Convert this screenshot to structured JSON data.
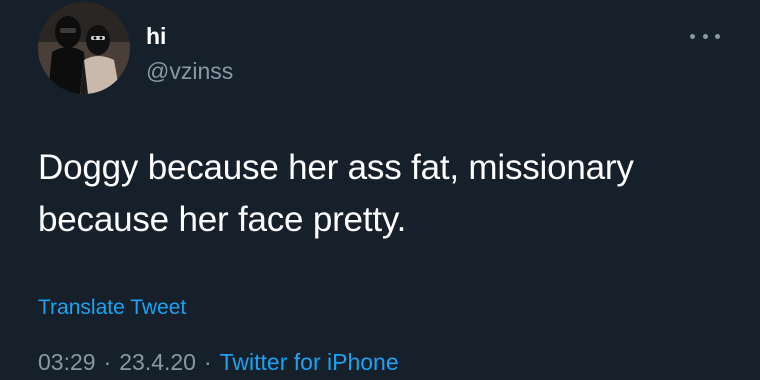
{
  "tweet": {
    "display_name": "hi",
    "handle": "@vzinss",
    "text": "Doggy because her ass fat, missionary because her face pretty.",
    "translate_label": "Translate Tweet",
    "time": "03:29",
    "date": "23.4.20",
    "separator": "·",
    "source": "Twitter for iPhone"
  },
  "icons": {
    "more": "more-horizontal-icon",
    "avatar": "profile-avatar"
  },
  "colors": {
    "background": "#15202b",
    "text_primary": "#ffffff",
    "text_secondary": "#8899a6",
    "accent": "#1da1f2"
  }
}
